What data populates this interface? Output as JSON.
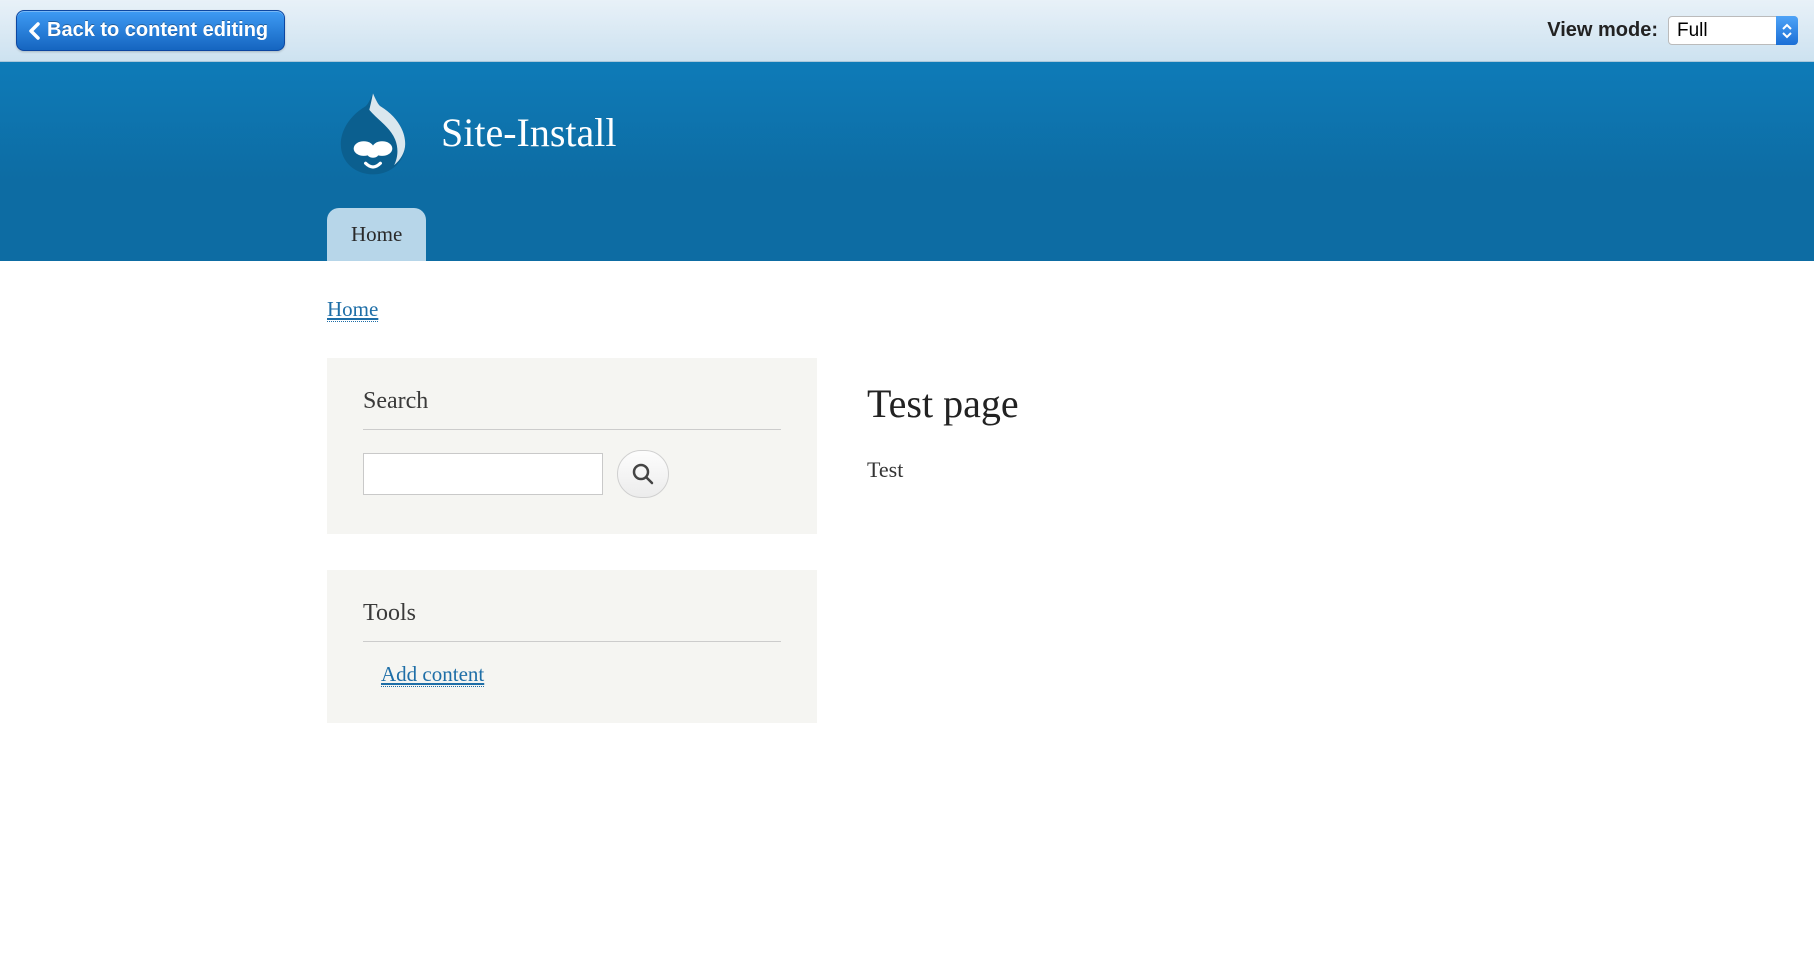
{
  "toolbar": {
    "back_label": "Back to content editing",
    "view_mode_label": "View mode:",
    "view_mode_value": "Full"
  },
  "site": {
    "name": "Site-Install"
  },
  "nav": {
    "items": [
      {
        "label": "Home"
      }
    ]
  },
  "breadcrumb": {
    "items": [
      {
        "label": "Home"
      }
    ]
  },
  "sidebar": {
    "search": {
      "title": "Search",
      "input_value": ""
    },
    "tools": {
      "title": "Tools",
      "links": [
        {
          "label": "Add content"
        }
      ]
    }
  },
  "main": {
    "title": "Test page",
    "body": "Test"
  }
}
